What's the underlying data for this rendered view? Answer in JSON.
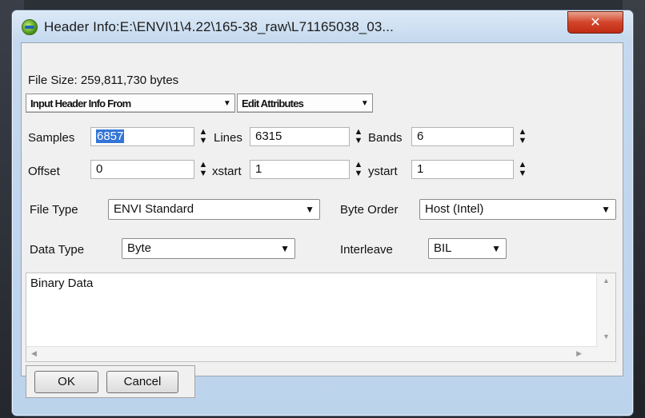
{
  "window": {
    "title": "Header Info:E:\\ENVI\\1\\4.22\\165-38_raw\\L71165038_03...",
    "close_label": "✕"
  },
  "file_size": "File Size: 259,811,730 bytes",
  "toolbar": {
    "input_header_label": "Input Header Info From",
    "edit_attributes_label": "Edit Attributes"
  },
  "fields": {
    "samples": {
      "label": "Samples",
      "value": "6857"
    },
    "lines": {
      "label": "Lines",
      "value": "6315"
    },
    "bands": {
      "label": "Bands",
      "value": "6"
    },
    "offset": {
      "label": "Offset",
      "value": "0"
    },
    "xstart": {
      "label": "xstart",
      "value": "1"
    },
    "ystart": {
      "label": "ystart",
      "value": "1"
    }
  },
  "selects": {
    "file_type": {
      "label": "File Type",
      "value": "ENVI Standard"
    },
    "byte_order": {
      "label": "Byte Order",
      "value": "Host (Intel)"
    },
    "data_type": {
      "label": "Data Type",
      "value": "Byte"
    },
    "interleave": {
      "label": "Interleave",
      "value": "BIL"
    }
  },
  "description": "Binary Data",
  "buttons": {
    "ok": "OK",
    "cancel": "Cancel"
  },
  "colors": {
    "selection": "#3375d6",
    "close": "#d3442a"
  }
}
